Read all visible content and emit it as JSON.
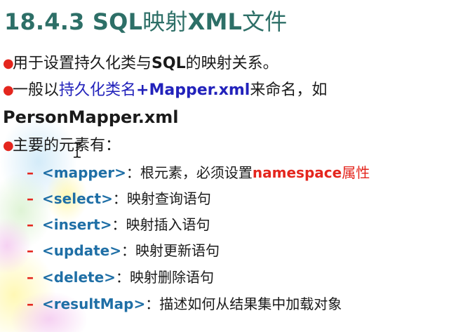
{
  "title": {
    "num": "18.4.3 ",
    "sql": "SQL",
    "mid": "映射",
    "xml": "XML",
    "tail": "文件"
  },
  "bullets": {
    "b1": {
      "a": "用于设置持久化类与",
      "b": "SQL",
      "c": "的映射关系。"
    },
    "b2": {
      "a": "一般以",
      "b": "持久化类名",
      "c": "+Mapper.xml",
      "d": "来命名，如",
      "cont": "PersonMapper.xml"
    },
    "b3": {
      "text": "主要的元素有："
    }
  },
  "elements": [
    {
      "tag": "<mapper>",
      "sep": "：",
      "desc": "根元素，必须设置",
      "extra": "namespace",
      "tail": "属性"
    },
    {
      "tag": "<select>",
      "sep": "：",
      "desc": "映射查询语句"
    },
    {
      "tag": "<insert>",
      "sep": "：",
      "desc": "映射插入语句"
    },
    {
      "tag": "<update>",
      "sep": "：",
      "desc": "映射更新语句"
    },
    {
      "tag": "<delete>",
      "sep": "：",
      "desc": "映射删除语句"
    },
    {
      "tag": "<resultMap>",
      "sep": "：",
      "desc": "描述如何从结果集中加载对象"
    }
  ],
  "colors": {
    "title": "#2d6f67",
    "bullet_dot": "#e4261e",
    "tag": "#1f6fa6",
    "highlight_blue": "#2222bb",
    "highlight_red": "#e4261e"
  },
  "icons": {
    "bullet": "bullet-dot-icon",
    "dash": "dash-icon",
    "cursor": "text-cursor-icon"
  }
}
